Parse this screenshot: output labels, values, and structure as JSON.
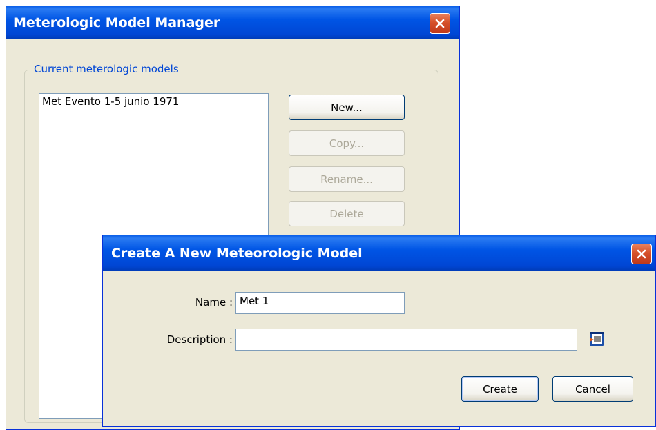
{
  "manager": {
    "title": "Meterologic Model Manager",
    "group_label": "Current meterologic models",
    "models": [
      "Met Evento 1-5 junio 1971"
    ],
    "buttons": {
      "new": "New...",
      "copy": "Copy...",
      "rename": "Rename...",
      "delete": "Delete"
    }
  },
  "create_dialog": {
    "title": "Create A New Meteorologic Model",
    "name_label": "Name :",
    "name_value": "Met 1",
    "description_label": "Description :",
    "description_value": "",
    "create_label": "Create",
    "cancel_label": "Cancel",
    "edit_description_icon": "edit-text-icon"
  },
  "colors": {
    "titlebar_blue": "#0054e3",
    "close_red": "#d6512a",
    "window_face": "#ece9d8",
    "group_label_blue": "#0046d5"
  }
}
